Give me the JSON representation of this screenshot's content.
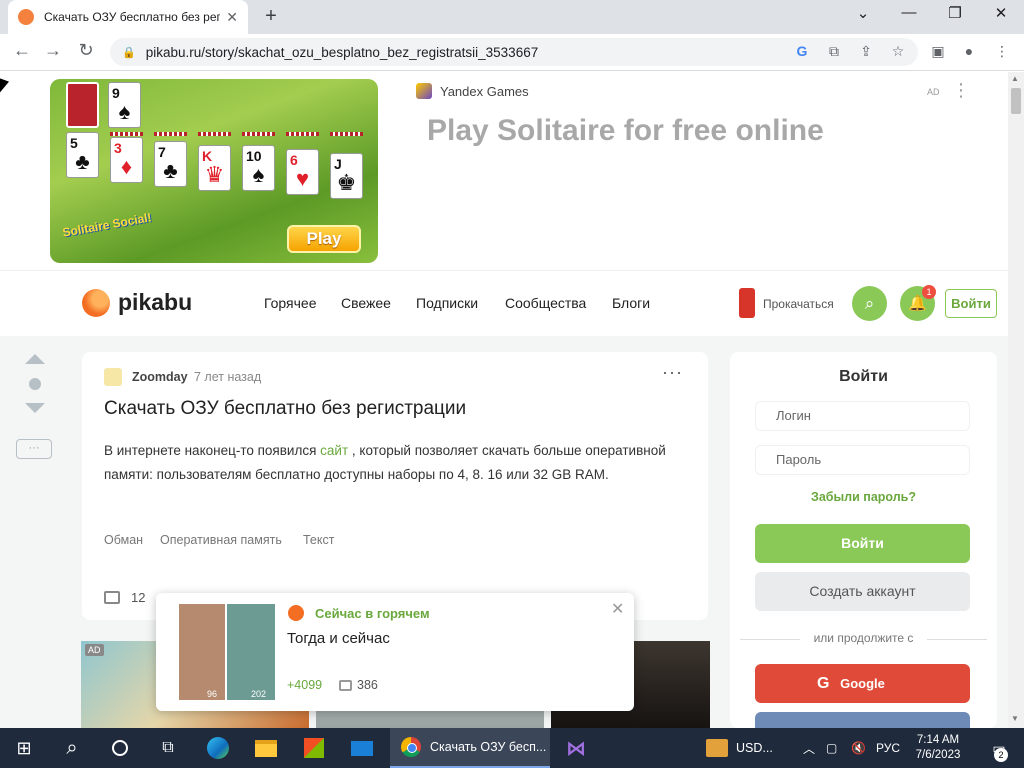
{
  "browser": {
    "tab_title": "Скачать ОЗУ бесплатно без рег",
    "tab_close": "✕",
    "new_tab": "+",
    "window_controls": {
      "dropdown": "⌄",
      "minimize": "—",
      "restore": "❐",
      "close": "✕"
    },
    "url": "pikabu.ru/story/skachat_ozu_besplatno_bez_registratsii_3533667",
    "nav": {
      "back": "←",
      "forward": "→",
      "reload": "↻"
    },
    "toolbar_icons": [
      "google-icon",
      "translate-icon",
      "share-icon",
      "bookmark-star-icon",
      "side-panel-icon",
      "profile-icon",
      "menu-icon"
    ]
  },
  "ad": {
    "brand": "Yandex Games",
    "headline": "Play Solitaire for free online",
    "label": "AD",
    "menu": "⋮",
    "play_button": "Play",
    "game_logo": "Solitaire Social!",
    "cards": [
      "9",
      "5",
      "3",
      "7",
      "K",
      "10",
      "6",
      "J"
    ]
  },
  "site_header": {
    "logo_text": "pikabu",
    "nav": [
      "Горячее",
      "Свежее",
      "Подписки",
      "Сообщества",
      "Блоги"
    ],
    "upgrade_text": "Прокачаться",
    "notifications_badge": "1",
    "login_button": "Войти"
  },
  "vote": {
    "save_label": "···"
  },
  "story": {
    "author": "Zoomday",
    "time": "7 лет назад",
    "more": "···",
    "title": "Скачать ОЗУ бесплатно без регистрации",
    "text_before": "В интернете наконец-то появился ",
    "text_link": "сайт",
    "text_after": " , который позволяет скачать больше оперативной памяти: пользователям бесплатно доступны наборы по 4, 8. 16 или 32 GB RAM.",
    "tags": [
      "Обман",
      "Оперативная память",
      "Текст"
    ],
    "comments": "12"
  },
  "sidebar": {
    "title": "Войти",
    "login_placeholder": "Логин",
    "password_placeholder": "Пароль",
    "forgot": "Забыли пароль?",
    "login_button": "Войти",
    "register_button": "Создать аккаунт",
    "or_continue": "или продолжите с",
    "google_button": "Google"
  },
  "feed": {
    "ad_badge": "AD"
  },
  "hot_popup": {
    "label": "Сейчас в горячем",
    "title": "Тогда и сейчас",
    "rating": "+4099",
    "comments": "386",
    "close": "✕",
    "thumb_years": [
      "96",
      "202"
    ]
  },
  "taskbar": {
    "chrome_label": "Скачать ОЗУ бесп...",
    "currency": "USD...",
    "language": "РУС",
    "time": "7:14 AM",
    "date": "7/6/2023",
    "notifications": "2"
  },
  "colors": {
    "pikabu_green": "#8ac858",
    "pikabu_orange": "#f36d22",
    "google_red": "#df4b38",
    "taskbar": "#1f2a3c"
  }
}
